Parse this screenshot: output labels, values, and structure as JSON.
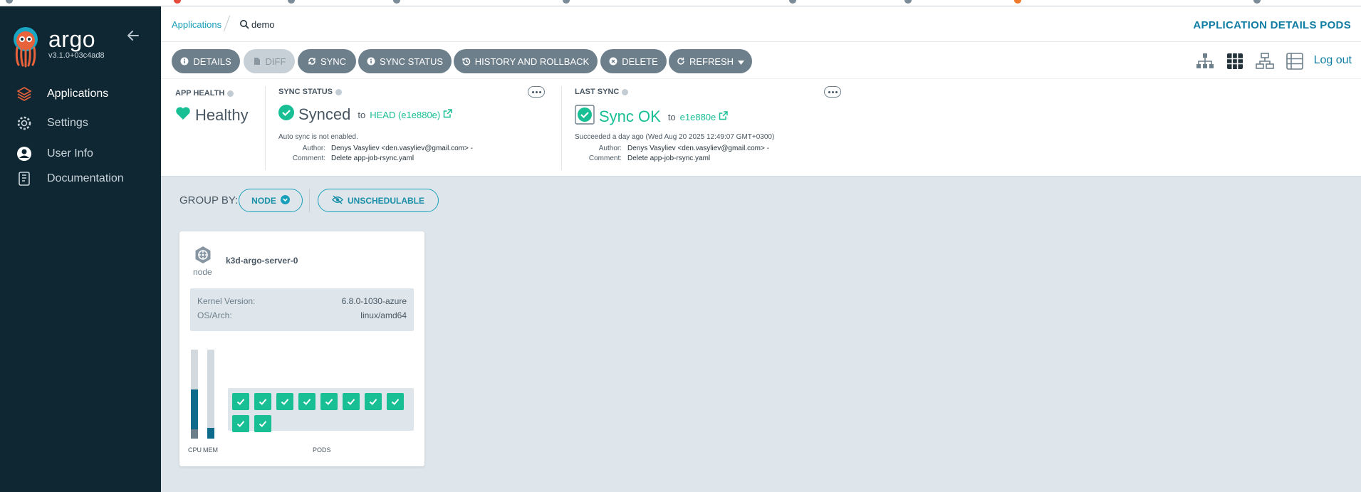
{
  "sidebar": {
    "brand": "argo",
    "version": "v3.1.0+03c4ad8",
    "items": [
      {
        "label": "Applications",
        "icon": "layers-icon"
      },
      {
        "label": "Settings",
        "icon": "gear-icon"
      },
      {
        "label": "User Info",
        "icon": "user-icon"
      },
      {
        "label": "Documentation",
        "icon": "book-icon"
      }
    ]
  },
  "header": {
    "breadcrumb_root": "Applications",
    "breadcrumb_current": "demo",
    "title": "APPLICATION DETAILS PODS"
  },
  "toolbar": {
    "details": "DETAILS",
    "diff": "DIFF",
    "sync": "SYNC",
    "sync_status": "SYNC STATUS",
    "history": "HISTORY AND ROLLBACK",
    "delete": "DELETE",
    "refresh": "REFRESH",
    "logout": "Log out"
  },
  "app_health": {
    "label": "APP HEALTH",
    "status": "Healthy"
  },
  "sync_status": {
    "label": "SYNC STATUS",
    "status": "Synced",
    "to": "to",
    "revision": "HEAD (e1e880e)",
    "auto_sync": "Auto sync is not enabled.",
    "author_label": "Author:",
    "author": "Denys Vasyliev <den.vasyliev@gmail.com> -",
    "comment_label": "Comment:",
    "comment": "Delete app-job-rsync.yaml"
  },
  "last_sync": {
    "label": "LAST SYNC",
    "status": "Sync OK",
    "to": "to",
    "revision": "e1e880e",
    "succeeded": "Succeeded a day ago (Wed Aug 20 2025 12:49:07 GMT+0300)",
    "author_label": "Author:",
    "author": "Denys Vasyliev <den.vasyliev@gmail.com> -",
    "comment_label": "Comment:",
    "comment": "Delete app-job-rsync.yaml"
  },
  "group_by": {
    "label": "GROUP BY:",
    "node": "NODE",
    "unschedulable": "UNSCHEDULABLE"
  },
  "node": {
    "kind": "node",
    "name": "k3d-argo-server-0",
    "kernel_label": "Kernel Version:",
    "kernel": "6.8.0-1030-azure",
    "os_label": "OS/Arch:",
    "os": "linux/amd64",
    "cpu_label": "CPU",
    "mem_label": "MEM",
    "pods_label": "PODS",
    "cpu_usage": 0.55,
    "cpu_request": 0.1,
    "mem_usage": 0.12,
    "pods": [
      "healthy",
      "healthy",
      "healthy",
      "healthy",
      "healthy",
      "healthy",
      "healthy",
      "healthy",
      "healthy",
      "healthy"
    ]
  },
  "colors": {
    "sidebar_bg": "#0f2733",
    "accent": "#1a9fba",
    "healthy": "#18be94",
    "button": "#6d7f8b",
    "bar_fill": "#0f6b8c"
  }
}
